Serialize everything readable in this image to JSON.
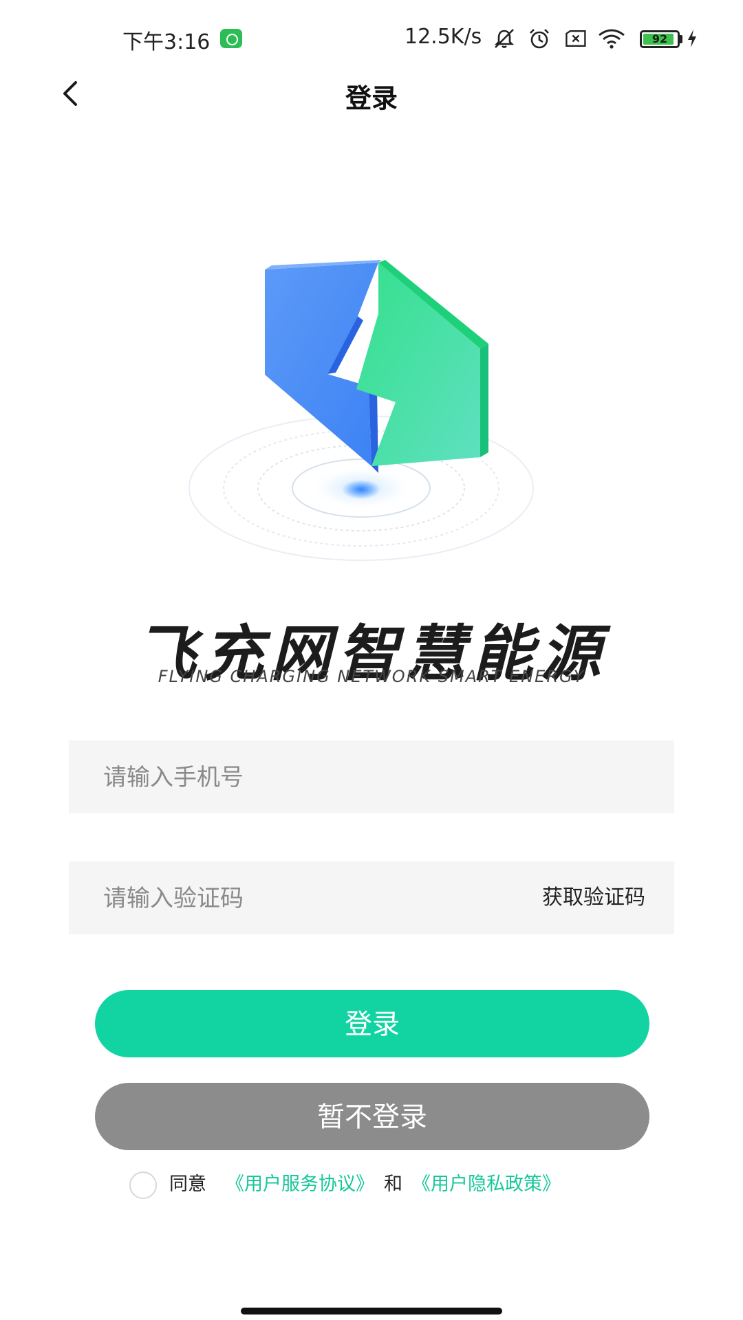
{
  "status_bar": {
    "time": "下午3:16",
    "network_speed": "12.5K/s",
    "battery_level": "92",
    "icons": [
      "wechat-icon",
      "mute-icon",
      "alarm-icon",
      "no-sim-icon",
      "wifi-icon",
      "battery-icon",
      "charging-icon"
    ]
  },
  "nav": {
    "back_icon": "chevron-left-icon",
    "title": "登录"
  },
  "brand": {
    "name_cn": "飞充网智慧能源",
    "name_en": "FLYING CHARGING NETWORK SMART ENERGY",
    "logo_colors": {
      "blue": "#3b7ff5",
      "green": "#1fe08f"
    }
  },
  "form": {
    "phone": {
      "value": "",
      "placeholder": "请输入手机号"
    },
    "code": {
      "value": "",
      "placeholder": "请输入验证码"
    },
    "get_code_label": "获取验证码"
  },
  "buttons": {
    "login_label": "登录",
    "login_color": "#12d4a2",
    "skip_label": "暂不登录",
    "skip_color": "#8c8c8c"
  },
  "agreement": {
    "prefix": "同意",
    "terms_link": "《用户服务协议》",
    "joiner": "和",
    "privacy_link": "《用户隐私政策》",
    "link_color": "#16c79a"
  }
}
